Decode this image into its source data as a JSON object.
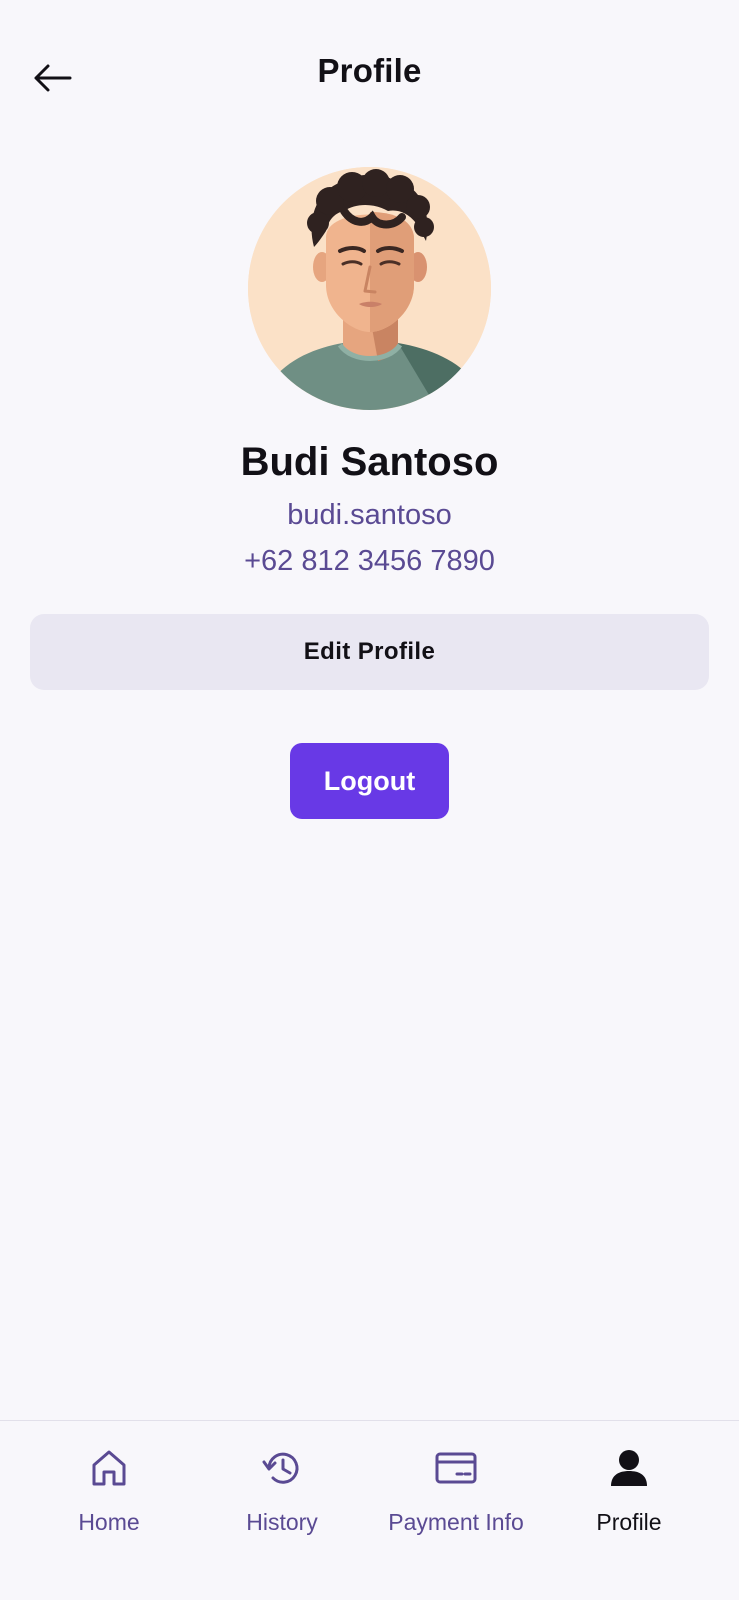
{
  "header": {
    "title": "Profile",
    "back_icon": "arrow-left-icon"
  },
  "profile": {
    "name": "Budi Santoso",
    "username": "budi.santoso",
    "phone": "+62 812 3456 7890",
    "avatar_icon": "user-avatar-illustration"
  },
  "actions": {
    "edit_label": "Edit Profile",
    "logout_label": "Logout"
  },
  "bottom_nav": {
    "items": [
      {
        "label": "Home",
        "icon": "home-icon",
        "active": false
      },
      {
        "label": "History",
        "icon": "history-icon",
        "active": false
      },
      {
        "label": "Payment Info",
        "icon": "card-icon",
        "active": false
      },
      {
        "label": "Profile",
        "icon": "person-icon",
        "active": true
      }
    ]
  },
  "colors": {
    "background": "#f8f7fb",
    "accent": "#6839e6",
    "secondary_text": "#5a4a93",
    "edit_button_bg": "#e9e7f2",
    "primary_text": "#121016"
  }
}
